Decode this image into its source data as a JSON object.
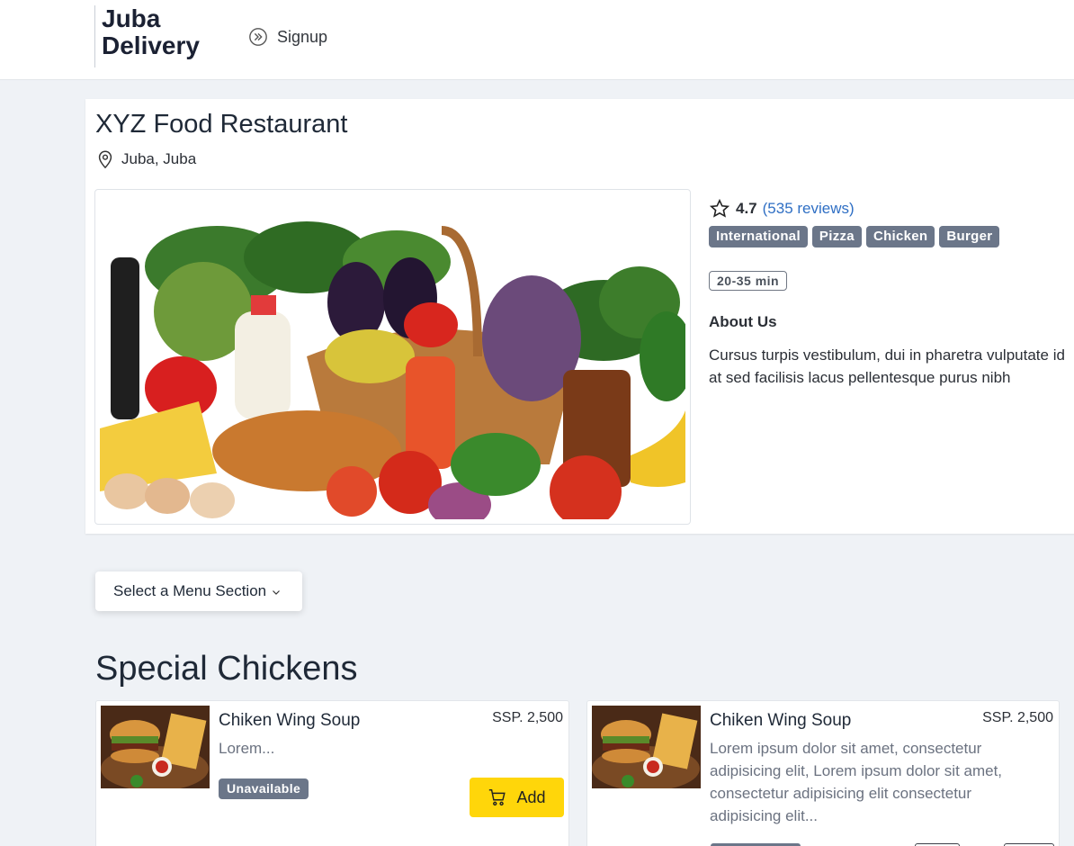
{
  "header": {
    "brand_line1": "Juba",
    "brand_line2": "Delivery",
    "signup_label": "Signup",
    "signup_icon": "chevrons-right-circle-icon"
  },
  "restaurant": {
    "name": "XYZ Food Restaurant",
    "location": "Juba, Juba",
    "location_icon": "map-pin-icon",
    "rating": "4.7",
    "reviews": "(535 reviews)",
    "tags": [
      "International",
      "Pizza",
      "Chicken",
      "Burger"
    ],
    "delivery_time": "20-35 min",
    "about_heading": "About Us",
    "about_line1": "Cursus turpis vestibulum, dui in pharetra vulputate id",
    "about_line2": "at sed facilisis lacus pellentesque purus nibh"
  },
  "menu": {
    "select_label": "Select a Menu Section",
    "section_title": "Special Chickens",
    "items": [
      {
        "name": "Chiken Wing Soup",
        "price": "SSP. 2,500",
        "description": "Lorem...",
        "status": "Unavailable",
        "add_label": "Add"
      },
      {
        "name": "Chiken Wing Soup",
        "price": "SSP. 2,500",
        "description_lines": [
          "Lorem ipsum dolor sit amet, consectetur",
          "adipisicing elit, Lorem ipsum dolor sit amet,",
          "consectetur adipisicing elit consectetur",
          "adipisicing elit..."
        ]
      }
    ]
  },
  "colors": {
    "accent_yellow": "#ffd60a",
    "link_blue": "#2f6fc4",
    "badge_gray": "#6b7689",
    "page_bg": "#eff2f6"
  }
}
